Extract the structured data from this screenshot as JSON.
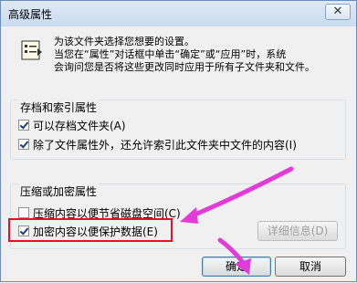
{
  "window": {
    "title": "高级属性",
    "close_label": "✕"
  },
  "intro": {
    "line1": "为该文件夹选择您想要的设置。",
    "line2": "当您在“属性”对话框中单击“确定”或“应用”时，系统",
    "line3": "会询问您是否将这些更改同时应用于所有子文件夹和文件。"
  },
  "archive_group": {
    "label": "存档和索引属性",
    "archive_checkbox": {
      "label": "可以存档文件夹(A)",
      "checked": true
    },
    "index_checkbox": {
      "label": "除了文件属性外，还允许索引此文件夹中文件的内容(I)",
      "checked": true
    }
  },
  "compress_group": {
    "label": "压缩或加密属性",
    "compress_checkbox": {
      "label": "压缩内容以便节省磁盘空间(C)",
      "checked": false
    },
    "encrypt_checkbox": {
      "label": "加密内容以便保护数据(E)",
      "checked": true
    },
    "details_button": "详细信息(D)"
  },
  "buttons": {
    "ok": "确定",
    "cancel": "取消"
  },
  "colors": {
    "highlight_border": "#e81123",
    "annotation_arrow": "#e23bd8"
  }
}
